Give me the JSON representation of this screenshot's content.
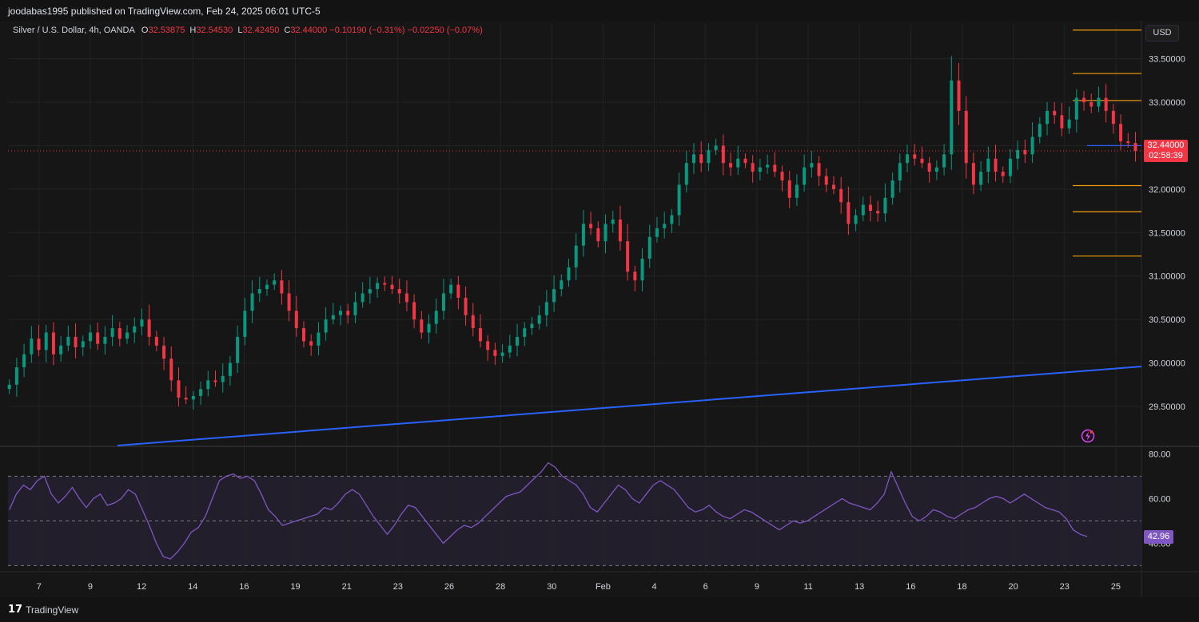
{
  "header": {
    "published": "joodabas1995 published on TradingView.com, Feb 24, 2025 06:01 UTC-5"
  },
  "legend": {
    "symbol": "Silver / U.S. Dollar, 4h, OANDA",
    "o_label": "O",
    "o_value": "32.53875",
    "h_label": "H",
    "h_value": "32.54530",
    "l_label": "L",
    "l_value": "32.42450",
    "c_label": "C",
    "c_value": "32.44000",
    "change": "−0.10190 (−0.31%)",
    "change2": "−0.02250 (−0.07%)"
  },
  "currency_button": "USD",
  "price_tag": {
    "price": "32.44000",
    "countdown": "02:58:39"
  },
  "rsi_tag": "42.96",
  "footer": {
    "brand": "TradingView",
    "logo_mark": "17"
  },
  "colors": {
    "up": "#089981",
    "down": "#f23645",
    "trendline": "#2962ff",
    "rsi": "#7e57c2",
    "levels": "#f59d0a",
    "grid": "#232323",
    "axis_text": "#d1d4dc"
  },
  "chart_data": [
    {
      "type": "candlestick",
      "title": "Silver / U.S. Dollar, 4h, OANDA",
      "ylim": [
        29.05,
        33.9
      ],
      "ytick_labels": [
        "29.50000",
        "30.00000",
        "30.50000",
        "31.00000",
        "31.50000",
        "32.00000",
        "32.50000",
        "33.00000",
        "33.50000"
      ],
      "ytick_values": [
        29.5,
        30.0,
        30.5,
        31.0,
        31.5,
        32.0,
        32.5,
        33.0,
        33.5
      ],
      "xtick_labels": [
        "7",
        "9",
        "12",
        "14",
        "16",
        "19",
        "21",
        "23",
        "26",
        "28",
        "30",
        "Feb",
        "4",
        "6",
        "9",
        "11",
        "13",
        "16",
        "18",
        "20",
        "23",
        "25"
      ],
      "xtick_index": [
        11,
        30,
        49,
        68,
        87,
        106,
        125,
        144,
        163,
        182,
        201,
        220,
        239,
        258,
        277,
        296,
        315,
        334,
        353,
        372,
        391,
        410
      ],
      "current_price": 32.44,
      "close_path": [
        29.75,
        29.95,
        30.1,
        30.28,
        30.15,
        30.35,
        30.1,
        30.2,
        30.3,
        30.18,
        30.25,
        30.35,
        30.22,
        30.3,
        30.4,
        30.28,
        30.35,
        30.42,
        30.5,
        30.3,
        30.2,
        30.05,
        29.8,
        29.6,
        29.58,
        29.62,
        29.7,
        29.8,
        29.78,
        29.85,
        30.0,
        30.3,
        30.6,
        30.8,
        30.85,
        30.9,
        30.95,
        30.8,
        30.6,
        30.4,
        30.25,
        30.2,
        30.35,
        30.5,
        30.55,
        30.6,
        30.55,
        30.7,
        30.8,
        30.85,
        30.92,
        30.9,
        30.85,
        30.8,
        30.7,
        30.5,
        30.35,
        30.45,
        30.6,
        30.8,
        30.9,
        30.75,
        30.55,
        30.4,
        30.25,
        30.15,
        30.08,
        30.12,
        30.2,
        30.3,
        30.4,
        30.45,
        30.55,
        30.7,
        30.85,
        30.95,
        31.1,
        31.35,
        31.6,
        31.55,
        31.4,
        31.6,
        31.65,
        31.4,
        31.05,
        30.95,
        31.2,
        31.45,
        31.55,
        31.6,
        31.7,
        32.05,
        32.3,
        32.4,
        32.3,
        32.45,
        32.5,
        32.3,
        32.25,
        32.35,
        32.3,
        32.2,
        32.25,
        32.28,
        32.2,
        32.1,
        31.9,
        32.05,
        32.25,
        32.3,
        32.15,
        32.05,
        32.0,
        31.85,
        31.6,
        31.7,
        31.82,
        31.75,
        31.72,
        31.9,
        32.1,
        32.3,
        32.4,
        32.35,
        32.3,
        32.2,
        32.25,
        32.4,
        33.25,
        32.9,
        32.3,
        32.05,
        32.2,
        32.35,
        32.2,
        32.15,
        32.35,
        32.45,
        32.4,
        32.6,
        32.75,
        32.9,
        32.85,
        32.7,
        32.8,
        33.05,
        33.0,
        32.95,
        33.05,
        32.9,
        32.75,
        32.55,
        32.53,
        32.44
      ]
    },
    {
      "type": "line",
      "title": "RSI",
      "ylim": [
        28.0,
        83.0
      ],
      "ytick_labels": [
        "40.00",
        "60.00",
        "80.00"
      ],
      "ytick_values": [
        40,
        60,
        80
      ],
      "bands": [
        30,
        50,
        70
      ],
      "values": [
        55,
        62,
        66,
        64,
        68,
        70,
        62,
        58,
        61,
        65,
        60,
        56,
        60,
        62,
        57,
        58,
        60,
        64,
        62,
        55,
        48,
        40,
        34,
        33,
        36,
        40,
        45,
        47,
        52,
        60,
        68,
        70,
        71,
        69,
        70,
        68,
        62,
        55,
        52,
        48,
        49,
        50,
        51,
        52,
        53,
        56,
        55,
        58,
        62,
        64,
        62,
        57,
        52,
        48,
        44,
        48,
        53,
        57,
        56,
        52,
        48,
        44,
        40,
        43,
        46,
        48,
        47,
        49,
        52,
        55,
        58,
        61,
        62,
        63,
        66,
        69,
        72,
        76,
        74,
        70,
        68,
        66,
        62,
        56,
        54,
        58,
        62,
        66,
        64,
        60,
        58,
        62,
        66,
        68,
        66,
        64,
        60,
        56,
        54,
        55,
        57,
        54,
        52,
        51,
        53,
        55,
        54,
        52,
        50,
        48,
        46,
        48,
        50,
        49,
        50,
        52,
        54,
        56,
        58,
        60,
        58,
        57,
        56,
        55,
        58,
        62,
        72,
        65,
        58,
        52,
        50,
        52,
        55,
        54,
        52,
        51,
        53,
        55,
        56,
        58,
        60,
        61,
        60,
        58,
        60,
        62,
        60,
        58,
        56,
        55,
        54,
        51,
        46,
        44,
        43
      ]
    }
  ]
}
